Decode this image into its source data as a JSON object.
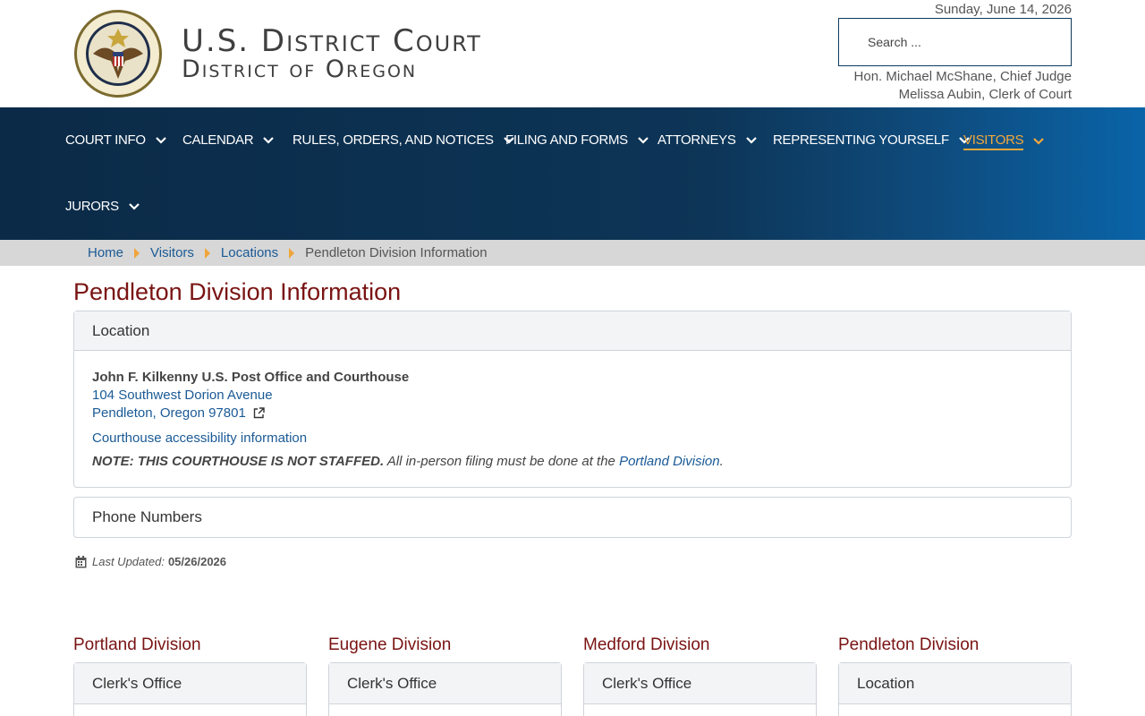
{
  "header": {
    "title_line1": "U.S. District Court",
    "title_line2": "District of Oregon",
    "date": "Sunday, June 14, 2026",
    "search_placeholder": "Search ...",
    "chief_judge": "Hon. Michael McShane, Chief Judge",
    "clerk": "Melissa Aubin, Clerk of Court",
    "seal_icon": "court-seal-eagle"
  },
  "nav": {
    "items": [
      {
        "label": "COURT INFO"
      },
      {
        "label": "CALENDAR"
      },
      {
        "label": "RULES, ORDERS, AND NOTICES"
      },
      {
        "label": "FILING AND FORMS"
      },
      {
        "label": "ATTORNEYS"
      },
      {
        "label": "REPRESENTING YOURSELF"
      },
      {
        "label": "VISITORS",
        "active": true
      },
      {
        "label": "JURORS"
      }
    ],
    "active_color": "#f3a83b"
  },
  "breadcrumb": {
    "items": [
      "Home",
      "Visitors",
      "Locations"
    ],
    "current": "Pendleton Division Information"
  },
  "main": {
    "title": "Pendleton Division Information",
    "location": {
      "heading": "Location",
      "building": "John F. Kilkenny U.S. Post Office and Courthouse",
      "address1": "104 Southwest Dorion Avenue",
      "address2": "Pendleton, Oregon 97801",
      "accessibility_link": "Courthouse accessibility information",
      "note_bold": "NOTE: THIS COURTHOUSE IS NOT STAFFED.",
      "note_text": " All in-person filing must be done at the ",
      "note_link": "Portland Division",
      "note_end": "."
    },
    "phone": {
      "heading": "Phone Numbers"
    },
    "updated": {
      "label": "Last Updated:",
      "value": "05/26/2026"
    }
  },
  "divisions": [
    {
      "title": "Portland Division",
      "card": "Clerk's Office"
    },
    {
      "title": "Eugene Division",
      "card": "Clerk's Office"
    },
    {
      "title": "Medford Division",
      "card": "Clerk's Office"
    },
    {
      "title": "Pendleton Division",
      "card": "Location"
    }
  ],
  "colors": {
    "nav_bg": "#0d3557",
    "title_red": "#7a1313",
    "link_blue": "#1a5a96",
    "accent_orange": "#f0a53a"
  }
}
